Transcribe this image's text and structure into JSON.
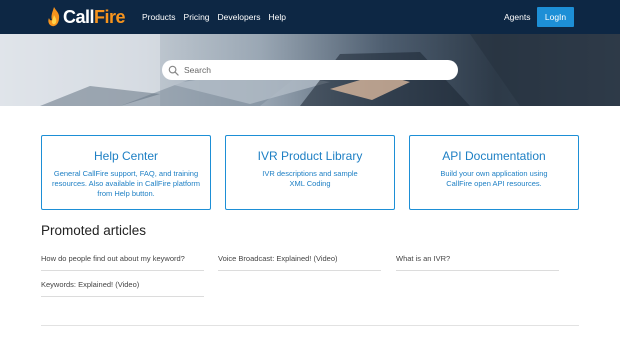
{
  "header": {
    "logo": {
      "prefix": "Call",
      "suffix": "Fire",
      "icon": "flame-icon"
    },
    "nav": [
      {
        "label": "Products"
      },
      {
        "label": "Pricing"
      },
      {
        "label": "Developers"
      },
      {
        "label": "Help"
      }
    ],
    "agents_label": "Agents",
    "login_label": "LogIn"
  },
  "search": {
    "placeholder": "Search",
    "icon": "search-icon"
  },
  "cards": [
    {
      "title": "Help Center",
      "description": "General CallFire support, FAQ, and training resources. Also available in CallFire platform from Help button."
    },
    {
      "title": "IVR Product Library",
      "description": "IVR descriptions and sample XML Coding"
    },
    {
      "title": "API Documentation",
      "description": "Build your own application using CallFire open API resources."
    }
  ],
  "promoted": {
    "title": "Promoted articles",
    "articles": [
      {
        "label": "How do people find out about my keyword?"
      },
      {
        "label": "Voice Broadcast: Explained! (Video)"
      },
      {
        "label": "What is an IVR?"
      },
      {
        "label": "Keywords: Explained! (Video)"
      }
    ]
  },
  "colors": {
    "navbar": "#0d2744",
    "brand_accent": "#f7941d",
    "link_blue": "#1d7fc4",
    "button_blue": "#1d8fd6"
  }
}
